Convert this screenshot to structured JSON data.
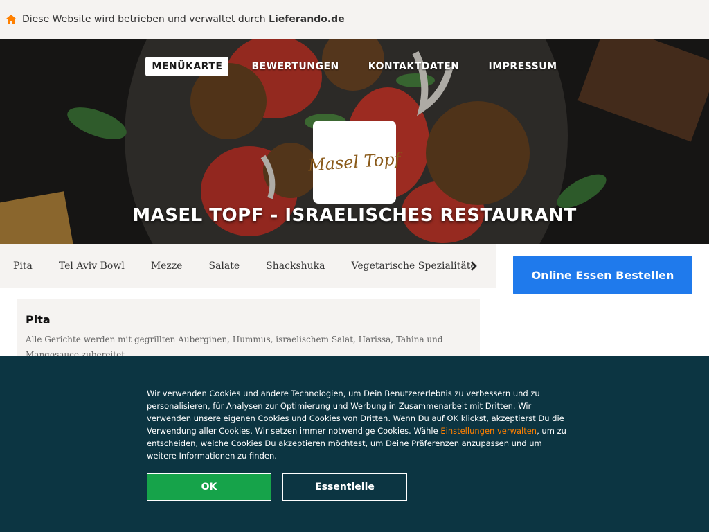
{
  "topbar": {
    "prefix": "Diese Website wird betrieben und verwaltet durch ",
    "brand": "Lieferando.de",
    "icon": "house-icon",
    "icon_color": "#ff8000"
  },
  "nav": {
    "items": [
      "MENÜKARTE",
      "BEWERTUNGEN",
      "KONTAKTDATEN",
      "IMPRESSUM"
    ],
    "active": "MENÜKARTE"
  },
  "logo": {
    "text": "Masel Topf"
  },
  "hero": {
    "title": "MASEL TOPF - ISRAELISCHES RESTAURANT"
  },
  "categories": {
    "items": [
      "Pita",
      "Tel Aviv Bowl",
      "Mezze",
      "Salate",
      "Shackshuka",
      "Vegetarische Spezialitäte"
    ],
    "next_icon": "chevron-right-icon"
  },
  "order": {
    "label": "Online Essen Bestellen",
    "color": "#1f7aec"
  },
  "section": {
    "title": "Pita",
    "description": "Alle Gerichte werden mit gegrillten Auberginen, Hummus, israelischem Salat, Harissa, Tahina und Mangosauce zubereitet."
  },
  "cookie": {
    "text_before": "Wir verwenden Cookies und andere Technologien, um Dein Benutzererlebnis zu verbessern und zu personalisieren, für Analysen zur Optimierung und Werbung in Zusammenarbeit mit Dritten. Wir verwenden unsere eigenen Cookies und Cookies von Dritten. Wenn Du auf OK klickst, akzeptierst Du die Verwendung aller Cookies. Wir setzen immer notwendige Cookies. Wähle ",
    "link": "Einstellungen verwalten",
    "text_after": ", um zu entscheiden, welche Cookies Du akzeptieren möchtest, um Deine Präferenzen anzupassen und um weitere Informationen zu finden.",
    "ok_label": "OK",
    "essential_label": "Essentielle",
    "background": "#0c3542",
    "ok_color": "#16a34a",
    "link_color": "#ff8000"
  }
}
